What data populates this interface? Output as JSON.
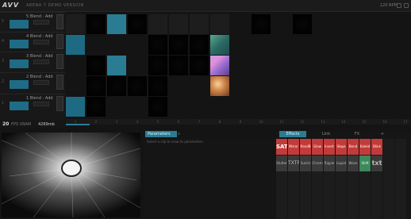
{
  "app": {
    "logo": "AVV",
    "subtitle": "ARENA 7 DEMO VERSION",
    "bpm": "120 BPM"
  },
  "icons": [
    "play-icon",
    "pause-icon",
    "settings-icon",
    "layout-icon"
  ],
  "layers": [
    {
      "num": "5",
      "name": "5 Blend : Add"
    },
    {
      "num": "4",
      "name": "4 Blend : Add"
    },
    {
      "num": "3",
      "name": "3 Blend : Add"
    },
    {
      "num": "2",
      "name": "2 Blend : Add"
    },
    {
      "num": "1",
      "name": "1 Blend : Add"
    }
  ],
  "status": {
    "count": "20",
    "label": "FPS VRAM",
    "value": "4269mb"
  },
  "columns": [
    "1",
    "2",
    "3",
    "4",
    "5",
    "6",
    "7",
    "8",
    "9",
    "10",
    "11",
    "12",
    "13",
    "14",
    "15",
    "16",
    "17"
  ],
  "params": {
    "tab": "Parameters",
    "close": "x",
    "hint": "Select a clip to view its parameters"
  },
  "right_tabs": [
    "Effects",
    "Link",
    "FX",
    "+"
  ],
  "effects": [
    {
      "label": "SAT",
      "style": "redbig"
    },
    {
      "label": "Mirror",
      "style": "red"
    },
    {
      "label": "RandB",
      "style": "red"
    },
    {
      "label": "Glow",
      "style": "red"
    },
    {
      "label": "Invert",
      "style": "red"
    },
    {
      "label": "Slope",
      "style": "red"
    },
    {
      "label": "Bend",
      "style": "red"
    },
    {
      "label": "Kaleid",
      "style": "red"
    },
    {
      "label": "Blink",
      "style": "red"
    },
    {
      "label": "Stutter",
      "style": "dark"
    },
    {
      "label": "TXTR",
      "style": "dark"
    },
    {
      "label": "Sunlin",
      "style": "dark"
    },
    {
      "label": "Chrom",
      "style": "dark"
    },
    {
      "label": "Ripple",
      "style": "dark"
    },
    {
      "label": "Liquid",
      "style": "dark"
    },
    {
      "label": "Wave",
      "style": "dark"
    },
    {
      "label": "Shift",
      "style": "green"
    },
    {
      "label": "txt",
      "style": "dark"
    }
  ]
}
